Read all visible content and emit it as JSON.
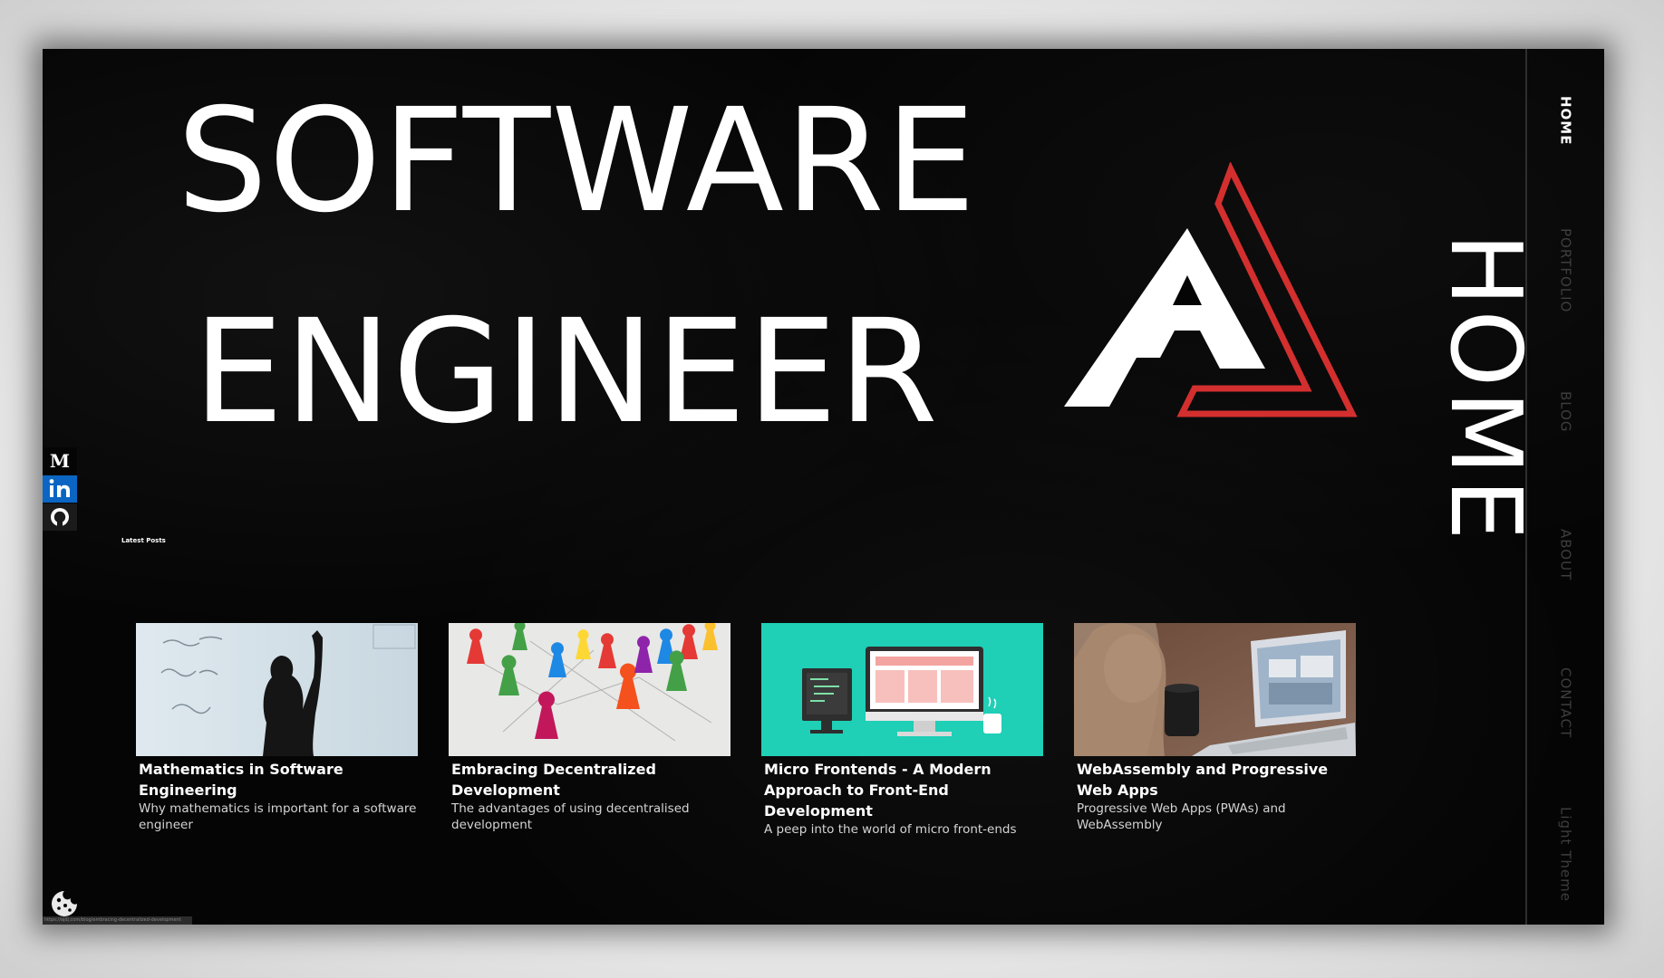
{
  "hero": {
    "line1": "SOFTWARE",
    "line2": "ENGINEER",
    "side_title": "HOME"
  },
  "brand_colors": {
    "accent": "#d32f2f",
    "background": "#050505",
    "text": "#ffffff"
  },
  "social": [
    {
      "name": "medium-icon",
      "label": "M"
    },
    {
      "name": "linkedin-icon",
      "label": "in"
    },
    {
      "name": "github-icon",
      "label": "github"
    }
  ],
  "latest_label": "Latest Posts",
  "posts": [
    {
      "title": "Mathematics in Software Engineering",
      "description": "Why mathematics is important for a software engineer",
      "image": "person-writing-math-on-whiteboard"
    },
    {
      "title": "Embracing Decentralized Development",
      "description": "The advantages of using decentralised development",
      "image": "colorful-pawns-network"
    },
    {
      "title": "Micro Frontends - A Modern Approach to Front-End Development",
      "description": "A peep into the world of micro front-ends",
      "image": "desktop-and-code-monitor-illustration"
    },
    {
      "title": "WebAssembly and Progressive Web Apps",
      "description": "Progressive Web Apps (PWAs) and WebAssembly",
      "image": "person-with-laptop-and-cup"
    }
  ],
  "nav": {
    "items": [
      {
        "label": "HOME",
        "active": true
      },
      {
        "label": "PORTFOLIO",
        "active": false
      },
      {
        "label": "BLOG",
        "active": false
      },
      {
        "label": "ABOUT",
        "active": false
      },
      {
        "label": "CONTACT",
        "active": false
      },
      {
        "label": "Light Theme",
        "active": false
      }
    ]
  },
  "status_url": "https://ajdj.com/blog/embracing-decentralized-development"
}
